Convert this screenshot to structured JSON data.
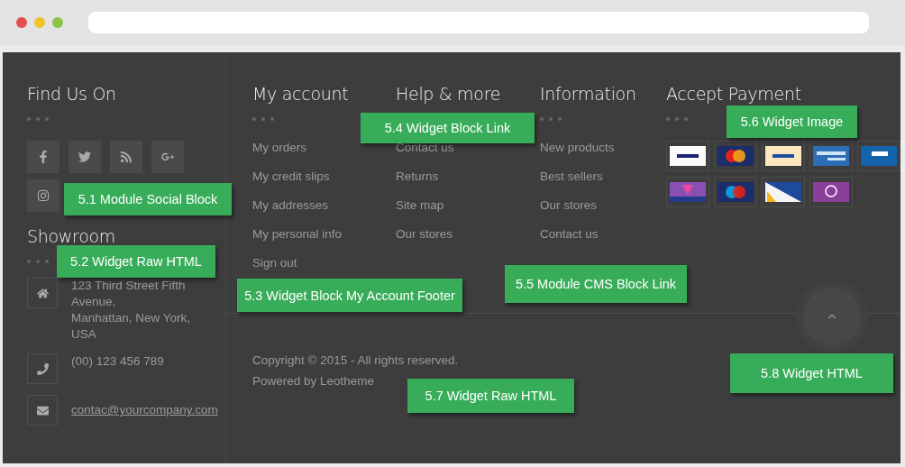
{
  "find_us": {
    "title": "Find Us On",
    "social": [
      {
        "kind": "facebook"
      },
      {
        "kind": "twitter"
      },
      {
        "kind": "rss"
      },
      {
        "kind": "google-plus"
      },
      {
        "kind": "instagram"
      }
    ]
  },
  "showroom": {
    "title": "Showroom",
    "contacts": [
      {
        "kind": "home",
        "text": "123 Third Street Fifth Avenue,\nManhattan, New York, USA"
      },
      {
        "kind": "phone",
        "text": "(00) 123 456 789"
      },
      {
        "kind": "mail",
        "text": "contac@yourcompany.com"
      }
    ]
  },
  "columns": [
    {
      "title": "My account",
      "links": [
        "My orders",
        "My credit slips",
        "My addresses",
        "My personal info",
        "Sign out"
      ]
    },
    {
      "title": "Help & more",
      "links": [
        "Contact us",
        "Returns",
        "Site map",
        "Our stores"
      ]
    },
    {
      "title": "Information",
      "links": [
        "New products",
        "Best sellers",
        "Our stores",
        "Contact us"
      ]
    }
  ],
  "payment": {
    "title": "Accept Payment",
    "cards": [
      {
        "kind": "visa"
      },
      {
        "kind": "mastercard"
      },
      {
        "kind": "paypal"
      },
      {
        "kind": "amex"
      },
      {
        "kind": "visa-electron"
      },
      {
        "kind": "laser"
      },
      {
        "kind": "maestro"
      },
      {
        "kind": "delta"
      },
      {
        "kind": "solo"
      }
    ]
  },
  "copyright": "Copyright © 2015 - All rights reserved.",
  "powered": "Powered by Leotheme",
  "annotations": [
    "5.1 Module Social Block",
    "5.2 Widget Raw HTML",
    "5.3 Widget Block My Account Footer",
    "5.4 Widget Block Link",
    "5.5 Module CMS Block Link",
    "5.6 Widget Image",
    "5.7 Widget Raw HTML",
    "5.8 Widget HTML"
  ]
}
